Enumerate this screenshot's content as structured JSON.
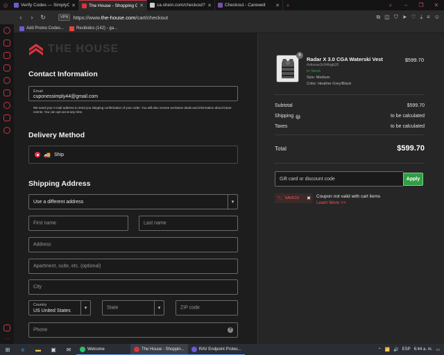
{
  "browser": {
    "tabs": [
      {
        "title": "Verify Codes — SimplyCod",
        "color": "#6d5bd0",
        "active": false
      },
      {
        "title": "The House - Shopping Cart",
        "color": "#d8343e",
        "active": true
      },
      {
        "title": "ca.shein.com/checkout?au",
        "color": "#cccccc",
        "active": false
      },
      {
        "title": "Checkout - Carewell",
        "color": "#7a4fb0",
        "active": false
      }
    ],
    "url_prefix": "https://www.",
    "url_domain": "the-house.com",
    "url_path": "/cart/checkout",
    "vpn_label": "VPN",
    "bookmarks": [
      "Add Promo Codes...",
      "Recibidos (142) - ga..."
    ]
  },
  "checkout": {
    "logo_text": "THE HOUSE",
    "contact_heading": "Contact Information",
    "email_label": "Email",
    "email_value": "cuponessimply44@gmail.com",
    "email_note": "We need your e-mail address to send you shipping confirmation of your order. You will also receive exclusive deals and information about future events. You can opt out at any time.",
    "delivery_heading": "Delivery Method",
    "ship_label": "Ship",
    "shipping_heading": "Shipping Address",
    "address_select": "Use a different address",
    "first_name_ph": "First name",
    "last_name_ph": "Last name",
    "address_ph": "Address",
    "apt_ph": "Apartment, suite, etc. (optional)",
    "city_ph": "City",
    "country_label": "Country",
    "country_value": "US United States",
    "state_ph": "State",
    "zip_ph": "ZIP code",
    "phone_ph": "Phone"
  },
  "summary": {
    "qty_badge": "6",
    "product_name": "Radar X 3.0 CGA Waterski Vest",
    "product_sku": "#vkvrax3c04hgb20",
    "stock": "In Stock",
    "size": "Size: Medium",
    "color": "Color: Heather Grey/Black",
    "product_price": "$599.70",
    "subtotal_label": "Subtotal",
    "subtotal_value": "$599.70",
    "shipping_label": "Shipping",
    "shipping_value": "to be calculated",
    "taxes_label": "Taxes",
    "taxes_value": "to be calculated",
    "total_label": "Total",
    "total_value": "$599.70",
    "discount_ph": "Gift card or discount code",
    "apply_label": "Apply",
    "coupon_code": "SAVE10",
    "coupon_error": "Coupon not valid with cart items",
    "learn_more": "Learn More >>"
  },
  "taskbar": {
    "tasks": [
      {
        "label": "Welcome",
        "color": "#2fbf6a"
      },
      {
        "label": "The House - Shoppin...",
        "color": "#d8343e"
      },
      {
        "label": "RAV Endpoint Protec...",
        "color": "#6d5bd0"
      }
    ],
    "lang": "ESP",
    "time": "6:44 a. m."
  }
}
